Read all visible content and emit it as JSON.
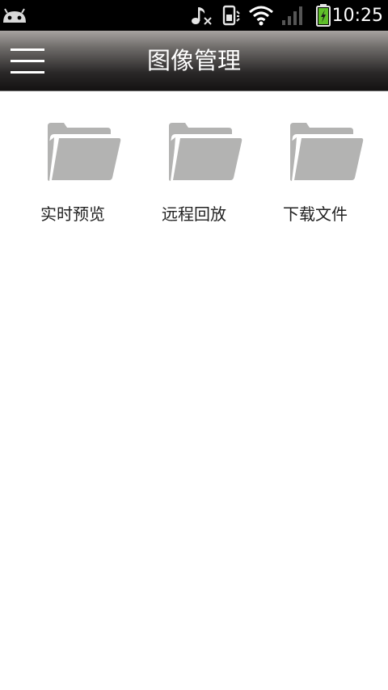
{
  "status_bar": {
    "time": "10:25",
    "icons": [
      "android-notification-icon",
      "music-muted-icon",
      "vibrate-icon",
      "wifi-icon",
      "signal-icon",
      "battery-charging-icon"
    ]
  },
  "header": {
    "title": "图像管理",
    "menu_icon": "hamburger-menu-icon"
  },
  "folders": [
    {
      "label": "实时预览",
      "icon": "folder-icon"
    },
    {
      "label": "远程回放",
      "icon": "folder-icon"
    },
    {
      "label": "下载文件",
      "icon": "folder-icon"
    }
  ],
  "colors": {
    "status_bar_bg": "#000000",
    "folder_gray": "#b3b3b2",
    "label_text": "#222222",
    "battery_green": "#5fbf2a"
  }
}
